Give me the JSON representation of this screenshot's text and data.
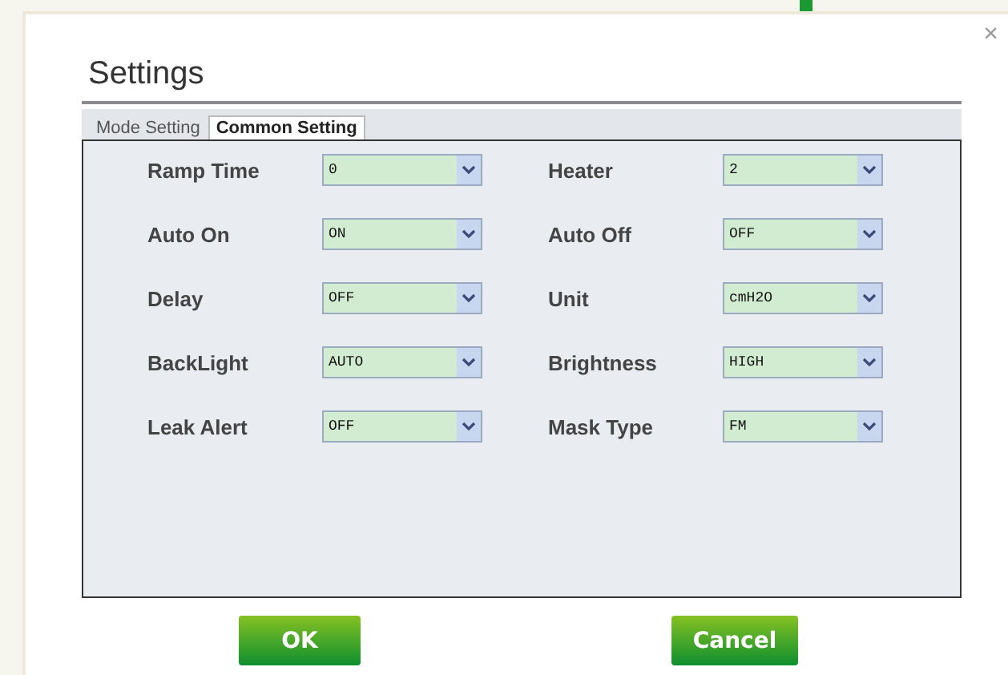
{
  "window": {
    "title": "Settings",
    "close": "×"
  },
  "tabs": [
    {
      "label": "Mode Setting",
      "selected": false
    },
    {
      "label": "Common Setting",
      "selected": true
    }
  ],
  "settings": [
    [
      {
        "label": "Ramp Time",
        "value": "0"
      },
      {
        "label": "Heater",
        "value": "2"
      }
    ],
    [
      {
        "label": "Auto On",
        "value": "ON"
      },
      {
        "label": "Auto Off",
        "value": "OFF"
      }
    ],
    [
      {
        "label": "Delay",
        "value": "OFF"
      },
      {
        "label": "Unit",
        "value": "cmH2O"
      }
    ],
    [
      {
        "label": "BackLight",
        "value": "AUTO"
      },
      {
        "label": "Brightness",
        "value": "HIGH"
      }
    ],
    [
      {
        "label": "Leak Alert",
        "value": "OFF"
      },
      {
        "label": "Mask Type",
        "value": "FM"
      }
    ]
  ],
  "buttons": [
    {
      "label": "OK"
    },
    {
      "label": "Cancel"
    }
  ]
}
